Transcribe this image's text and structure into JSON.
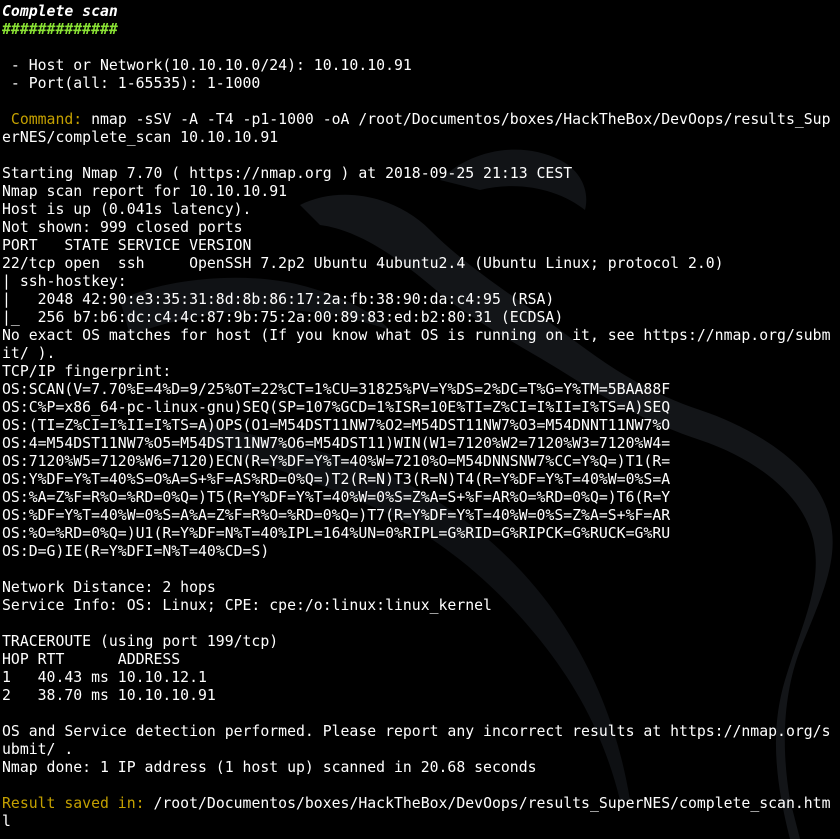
{
  "colors": {
    "background": "#000000",
    "text": "#ffffff",
    "hash_green": "#8ae234",
    "label_yellow": "#c4a000"
  },
  "header": {
    "title": "Complete scan",
    "underline": "#############"
  },
  "prompts": {
    "host_line": " - Host or Network(10.10.10.0/24): 10.10.10.91",
    "port_line": " - Port(all: 1-65535): 1-1000"
  },
  "command": {
    "label": " Command:",
    "text_1": " nmap -sSV -A -T4 -p1-1000 -oA /root/Documentos/boxes/HackTheBox/DevOops/results_Sup",
    "text_2": "erNES/complete_scan 10.10.10.91"
  },
  "output": {
    "lines": [
      "Starting Nmap 7.70 ( https://nmap.org ) at 2018-09-25 21:13 CEST",
      "Nmap scan report for 10.10.10.91",
      "Host is up (0.041s latency).",
      "Not shown: 999 closed ports",
      "PORT   STATE SERVICE VERSION",
      "22/tcp open  ssh     OpenSSH 7.2p2 Ubuntu 4ubuntu2.4 (Ubuntu Linux; protocol 2.0)",
      "| ssh-hostkey: ",
      "|   2048 42:90:e3:35:31:8d:8b:86:17:2a:fb:38:90:da:c4:95 (RSA)",
      "|_  256 b7:b6:dc:c4:4c:87:9b:75:2a:00:89:83:ed:b2:80:31 (ECDSA)",
      "No exact OS matches for host (If you know what OS is running on it, see https://nmap.org/subm",
      "it/ ).",
      "TCP/IP fingerprint:",
      "OS:SCAN(V=7.70%E=4%D=9/25%OT=22%CT=1%CU=31825%PV=Y%DS=2%DC=T%G=Y%TM=5BAA88F",
      "OS:C%P=x86_64-pc-linux-gnu)SEQ(SP=107%GCD=1%ISR=10E%TI=Z%CI=I%II=I%TS=A)SEQ",
      "OS:(TI=Z%CI=I%II=I%TS=A)OPS(O1=M54DST11NW7%O2=M54DST11NW7%O3=M54DNNT11NW7%O",
      "OS:4=M54DST11NW7%O5=M54DST11NW7%O6=M54DST11)WIN(W1=7120%W2=7120%W3=7120%W4=",
      "OS:7120%W5=7120%W6=7120)ECN(R=Y%DF=Y%T=40%W=7210%O=M54DNNSNW7%CC=Y%Q=)T1(R=",
      "OS:Y%DF=Y%T=40%S=O%A=S+%F=AS%RD=0%Q=)T2(R=N)T3(R=N)T4(R=Y%DF=Y%T=40%W=0%S=A",
      "OS:%A=Z%F=R%O=%RD=0%Q=)T5(R=Y%DF=Y%T=40%W=0%S=Z%A=S+%F=AR%O=%RD=0%Q=)T6(R=Y",
      "OS:%DF=Y%T=40%W=0%S=A%A=Z%F=R%O=%RD=0%Q=)T7(R=Y%DF=Y%T=40%W=0%S=Z%A=S+%F=AR",
      "OS:%O=%RD=0%Q=)U1(R=Y%DF=N%T=40%IPL=164%UN=0%RIPL=G%RID=G%RIPCK=G%RUCK=G%RU",
      "OS:D=G)IE(R=Y%DFI=N%T=40%CD=S)",
      "",
      "Network Distance: 2 hops",
      "Service Info: OS: Linux; CPE: cpe:/o:linux:linux_kernel",
      "",
      "TRACEROUTE (using port 199/tcp)",
      "HOP RTT      ADDRESS",
      "1   40.43 ms 10.10.12.1",
      "2   38.70 ms 10.10.10.91",
      "",
      "OS and Service detection performed. Please report any incorrect results at https://nmap.org/s",
      "ubmit/ .",
      "Nmap done: 1 IP address (1 host up) scanned in 20.68 seconds"
    ]
  },
  "result": {
    "label": "Result saved in:",
    "path_1": " /root/Documentos/boxes/HackTheBox/DevOops/results_SuperNES/complete_scan.htm",
    "path_2": "l"
  }
}
